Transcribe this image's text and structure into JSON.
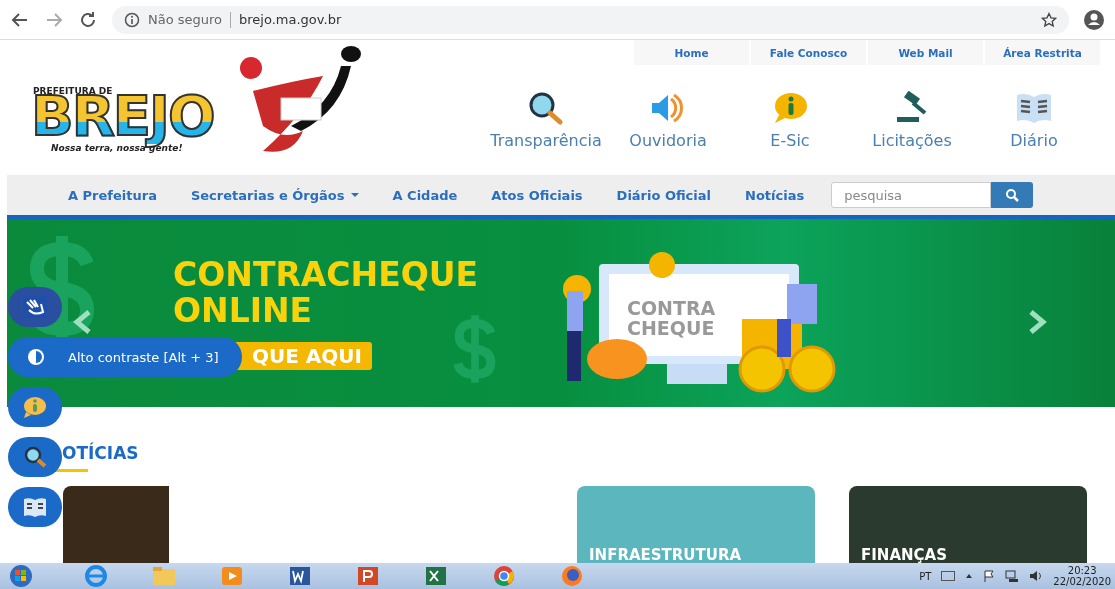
{
  "browser": {
    "security": "Não seguro",
    "url": "brejo.ma.gov.br"
  },
  "top_links": [
    "Home",
    "Fale Conosco",
    "Web Mail",
    "Área Restrita"
  ],
  "logo": {
    "top": "PREFEITURA DE",
    "name": "BREJO",
    "slogan": "Nossa terra, nossa gente!"
  },
  "quick_links": [
    {
      "label": "Transparência",
      "kind": "search"
    },
    {
      "label": "Ouvidoria",
      "kind": "speaker"
    },
    {
      "label": "E-Sic",
      "kind": "info"
    },
    {
      "label": "Licitações",
      "kind": "gavel"
    },
    {
      "label": "Diário",
      "kind": "book"
    }
  ],
  "nav": {
    "items": [
      {
        "label": "A Prefeitura",
        "dropdown": false
      },
      {
        "label": "Secretarias e Órgãos",
        "dropdown": true
      },
      {
        "label": "A Cidade",
        "dropdown": false
      },
      {
        "label": "Atos Oficiais",
        "dropdown": false
      },
      {
        "label": "Diário Oficial",
        "dropdown": false
      },
      {
        "label": "Notícias",
        "dropdown": false
      }
    ],
    "search_placeholder": "pesquisa"
  },
  "banner": {
    "title_lines": [
      "CONTRACHEQUE",
      "ONLINE"
    ],
    "button": "QUE AQUI",
    "screen_lines": [
      "CONTRA",
      "CHEQUE"
    ]
  },
  "accessibility": [
    {
      "kind": "hands"
    },
    {
      "kind": "contrast",
      "tooltip": "Alto contraste [Alt + 3]"
    },
    {
      "kind": "info"
    },
    {
      "kind": "search"
    },
    {
      "kind": "book"
    }
  ],
  "news": {
    "heading": "OTÍCIAS",
    "cards": [
      {
        "kind": "logo-image"
      },
      {
        "kind": "utilities",
        "caption": "INFRAESTRUTURA"
      },
      {
        "kind": "chamber",
        "caption": "FINANÇAS"
      }
    ]
  },
  "taskbar": {
    "apps": [
      {
        "kind": "explorer"
      },
      {
        "kind": "folder"
      },
      {
        "kind": "media"
      },
      {
        "kind": "word"
      },
      {
        "kind": "powerpoint"
      },
      {
        "kind": "excel"
      },
      {
        "kind": "chrome"
      },
      {
        "kind": "firefox"
      }
    ],
    "language": "PT",
    "time": "20:23",
    "date": "22/02/2020"
  }
}
